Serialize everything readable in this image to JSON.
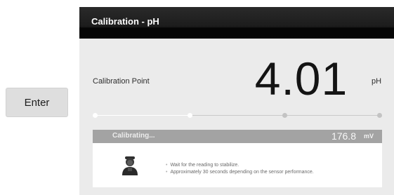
{
  "enter_button": {
    "label": "Enter"
  },
  "panel": {
    "title": "Calibration - pH"
  },
  "calibration": {
    "label": "Calibration Point",
    "value": "4.01",
    "unit": "pH"
  },
  "progress": {
    "steps": 4,
    "completed": 2
  },
  "status": {
    "text": "Calibrating...",
    "reading": "176.8",
    "reading_unit": "mV"
  },
  "info": {
    "icon": "person-icon",
    "messages": [
      "Wait for the reading to stabilize.",
      "Approximately 30 seconds depending on the sensor performance."
    ]
  },
  "colors": {
    "header": "#0a0a0a",
    "panel": "#ebebeb",
    "status_bar": "#a3a3a3"
  }
}
